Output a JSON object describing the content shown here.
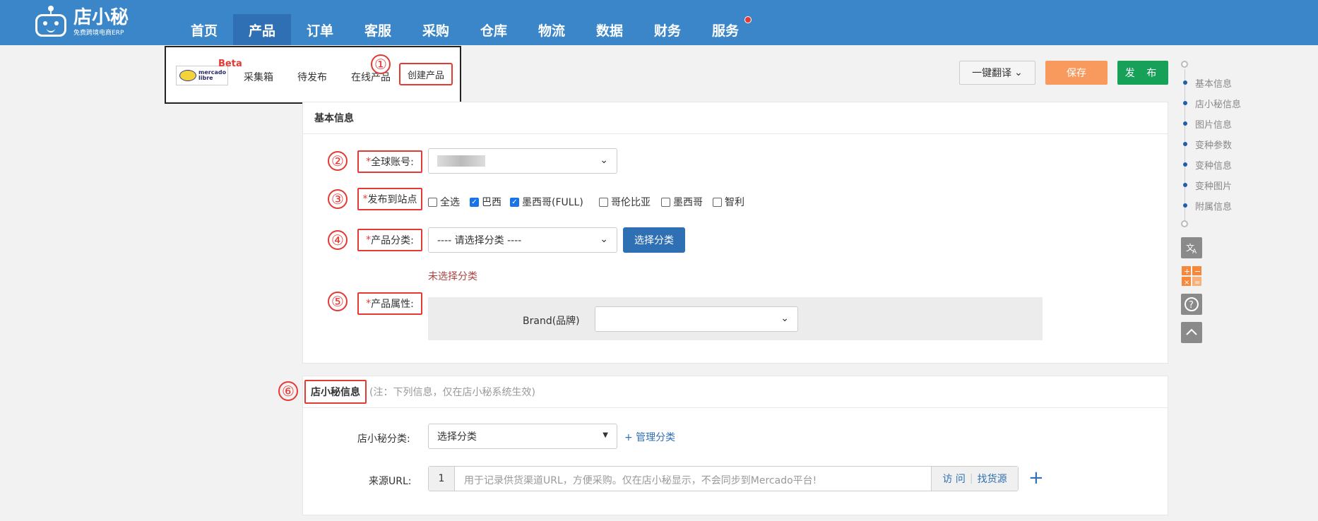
{
  "app": {
    "name": "店小秘",
    "tagline": "免费跨境电商ERP"
  },
  "nav": {
    "items": [
      {
        "label": "首页"
      },
      {
        "label": "产品"
      },
      {
        "label": "订单"
      },
      {
        "label": "客服"
      },
      {
        "label": "采购"
      },
      {
        "label": "仓库"
      },
      {
        "label": "物流"
      },
      {
        "label": "数据"
      },
      {
        "label": "财务"
      },
      {
        "label": "服务"
      }
    ],
    "active": "产品"
  },
  "submenu": {
    "logo_text_1": "mercado",
    "logo_text_2": "libre",
    "beta": "Beta",
    "items": [
      "采集箱",
      "待发布",
      "在线产品"
    ],
    "create": "创建产品"
  },
  "toolbar": {
    "translate": "一键翻译",
    "save": "保存",
    "publish": "发 布"
  },
  "annotations": [
    "①",
    "②",
    "③",
    "④",
    "⑤",
    "⑥"
  ],
  "basic": {
    "title": "基本信息",
    "account_label": "全球账号:",
    "site_label": "发布到站点",
    "sites": [
      {
        "label": "全选",
        "checked": false
      },
      {
        "label": "巴西",
        "checked": true
      },
      {
        "label": "墨西哥(FULL)",
        "checked": true
      },
      {
        "label": "哥伦比亚",
        "checked": false
      },
      {
        "label": "墨西哥",
        "checked": false
      },
      {
        "label": "智利",
        "checked": false
      }
    ],
    "category_label": "产品分类:",
    "category_placeholder": "---- 请选择分类 ----",
    "category_button": "选择分类",
    "category_warning": "未选择分类",
    "attr_label": "产品属性:",
    "brand_label": "Brand(品牌)"
  },
  "dxm": {
    "title": "店小秘信息",
    "note": "(注：下列信息，仅在店小秘系统生效)",
    "category_label": "店小秘分类:",
    "category_value": "选择分类",
    "manage_link": "+ 管理分类",
    "url_label": "来源URL:",
    "url_index": "1",
    "url_placeholder": "用于记录供货渠道URL，方便采购。仅在店小秘显示，不会同步到Mercado平台!",
    "visit": "访 问",
    "find_source": "找货源",
    "add": "+"
  },
  "timeline": [
    "基本信息",
    "店小秘信息",
    "图片信息",
    "变种参数",
    "变种信息",
    "变种图片",
    "附属信息"
  ],
  "colors": {
    "nav": "#3a86c8",
    "save": "#f89a5d",
    "publish": "#16a058",
    "accent": "#2f6fb3",
    "annotation": "#e53935"
  }
}
